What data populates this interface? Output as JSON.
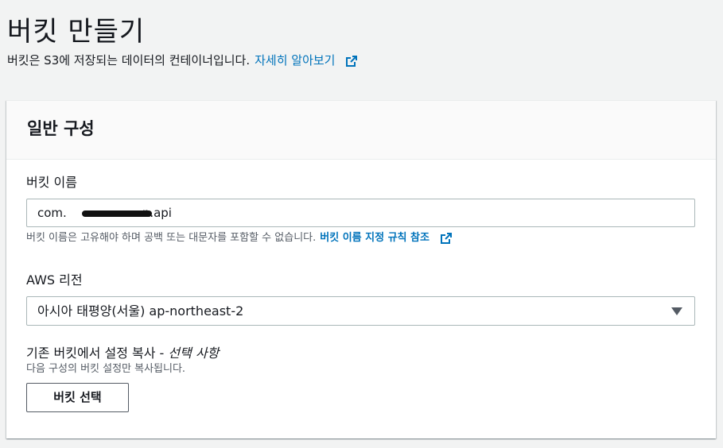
{
  "header": {
    "title": "버킷 만들기",
    "description": "버킷은 S3에 저장되는 데이터의 컨테이너입니다.",
    "learn_more": "자세히 알아보기"
  },
  "general": {
    "title": "일반 구성",
    "bucket_name": {
      "label": "버킷 이름",
      "value": "com.            n.api",
      "value_prefix": "com.",
      "value_suffix": "n.api",
      "hint": "버킷 이름은 고유해야 하며 공백 또는 대문자를 포함할 수 없습니다.",
      "rules_link": "버킷 이름 지정 규칙 참조"
    },
    "region": {
      "label": "AWS 리전",
      "selected": "아시아 태평양(서울) ap-northeast-2"
    },
    "copy_settings": {
      "label": "기존 버킷에서 설정 복사 -",
      "optional": "선택 사항",
      "hint": "다음 구성의 버킷 설정만 복사됩니다.",
      "button": "버킷 선택"
    }
  },
  "icons": [
    "external-link-icon",
    "dropdown-caret-icon"
  ],
  "colors": {
    "link": "#0073bb",
    "text": "#16191f",
    "muted": "#545b64",
    "background": "#f2f3f3"
  }
}
